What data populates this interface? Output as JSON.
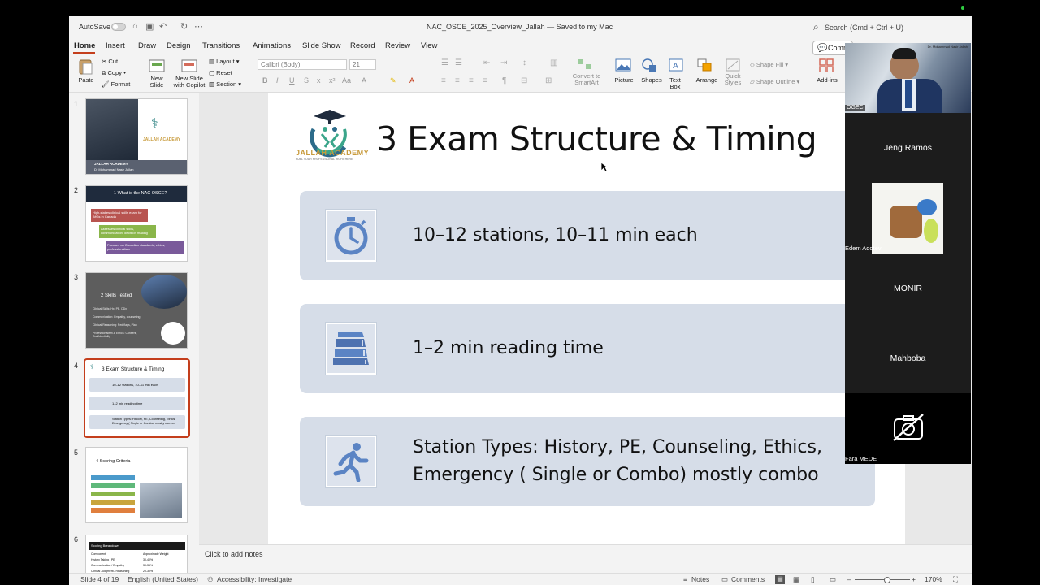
{
  "titlebar": {
    "autosave": "AutoSave",
    "doc_title": "NAC_OSCE_2025_Overview_Jallah — Saved to my Mac",
    "search_placeholder": "Search (Cmd + Ctrl + U)"
  },
  "tabs": [
    "Home",
    "Insert",
    "Draw",
    "Design",
    "Transitions",
    "Animations",
    "Slide Show",
    "Record",
    "Review",
    "View"
  ],
  "comments_button": "Comm",
  "ribbon": {
    "paste": "Paste",
    "cut": "Cut",
    "copy": "Copy",
    "format": "Format",
    "new_slide": "New Slide",
    "new_slide_copilot": "New Slide with Copilot",
    "layout": "Layout",
    "reset": "Reset",
    "section": "Section",
    "font_name": "Calibri (Body)",
    "font_size": "21",
    "convert_smartart": "Convert to SmartArt",
    "picture": "Picture",
    "shapes": "Shapes",
    "text_box": "Text Box",
    "arrange": "Arrange",
    "quick_styles": "Quick Styles",
    "shape_fill": "Shape Fill",
    "shape_outline": "Shape Outline",
    "addins": "Add-ins"
  },
  "thumbnails": [
    {
      "num": "1",
      "line1": "JALLAH ACADEMY",
      "line2": "Dr Mohammad Nasir Jallah",
      "logo": "JALLAH ACADEMY"
    },
    {
      "num": "2",
      "title": "1 What is the NAC OSCE?",
      "b1": "High-stakes clinical skills exam for IMGs in Canada",
      "b2": "Assesses clinical skills, communication, decision making",
      "b3": "Focuses on Canadian standards, ethics, professionalism"
    },
    {
      "num": "3",
      "title": "2 Skills Tested",
      "l1": "Clinical Skills: Hx, PE, DDx",
      "l2": "Communication: Empathy, counseling",
      "l3": "Clinical Reasoning: Red flags, Plan",
      "l4": "Professionalism & Ethics: Consent, Confidentiality"
    },
    {
      "num": "4",
      "title": "3 Exam Structure & Timing",
      "r1": "10–12 stations, 10–11 min each",
      "r2": "1–2 min reading time",
      "r3": "Station Types: History, PE, Counseling, Ethics, Emergency ( Single or Combo) mostly combo"
    },
    {
      "num": "5",
      "title": "4 Scoring Criteria"
    },
    {
      "num": "6",
      "title": "Scoring Breakdown",
      "h1": "Component",
      "h2": "Approximate Weight",
      "rows": [
        [
          "History Taking / PE",
          "30-40%"
        ],
        [
          "Communication / Empathy",
          "30-35%"
        ],
        [
          "Clinical Judgment / Reasoning",
          "20-30%"
        ]
      ]
    }
  ],
  "slide": {
    "logo_text": "JALLAH ACADEMY",
    "logo_sub": "FUEL YOUR PROFESSIONAL RIGHT HERE",
    "title": "3 Exam Structure & Timing",
    "cards": [
      {
        "icon": "stopwatch-icon",
        "text": "10–12 stations, 10–11 min each"
      },
      {
        "icon": "books-icon",
        "text": "1–2 min reading time"
      },
      {
        "icon": "runner-icon",
        "text_line1": "Station Types: History, PE, Counseling, Ethics,",
        "text_line2": "Emergency ( Single or Combo) mostly combo"
      }
    ]
  },
  "notes_placeholder": "Click to add notes",
  "status": {
    "slide_info": "Slide 4 of 19",
    "language": "English (United States)",
    "accessibility": "Accessibility: Investigate",
    "notes": "Notes",
    "comments": "Comments",
    "zoom": "170%"
  },
  "video": {
    "presenter_label": "Dr. Mohammad Nasir Jallah",
    "ogec_label": "OGEC",
    "participants": [
      {
        "name": "Jeng Ramos"
      },
      {
        "name": "Edem Adotevi"
      },
      {
        "name": "MONIR"
      },
      {
        "name": "Mahboba"
      },
      {
        "name": "Fara MEDE"
      }
    ]
  },
  "colors": {
    "accent": "#c43e1c",
    "card_bg": "#d6dde8",
    "icon_blue": "#5b84c4"
  }
}
